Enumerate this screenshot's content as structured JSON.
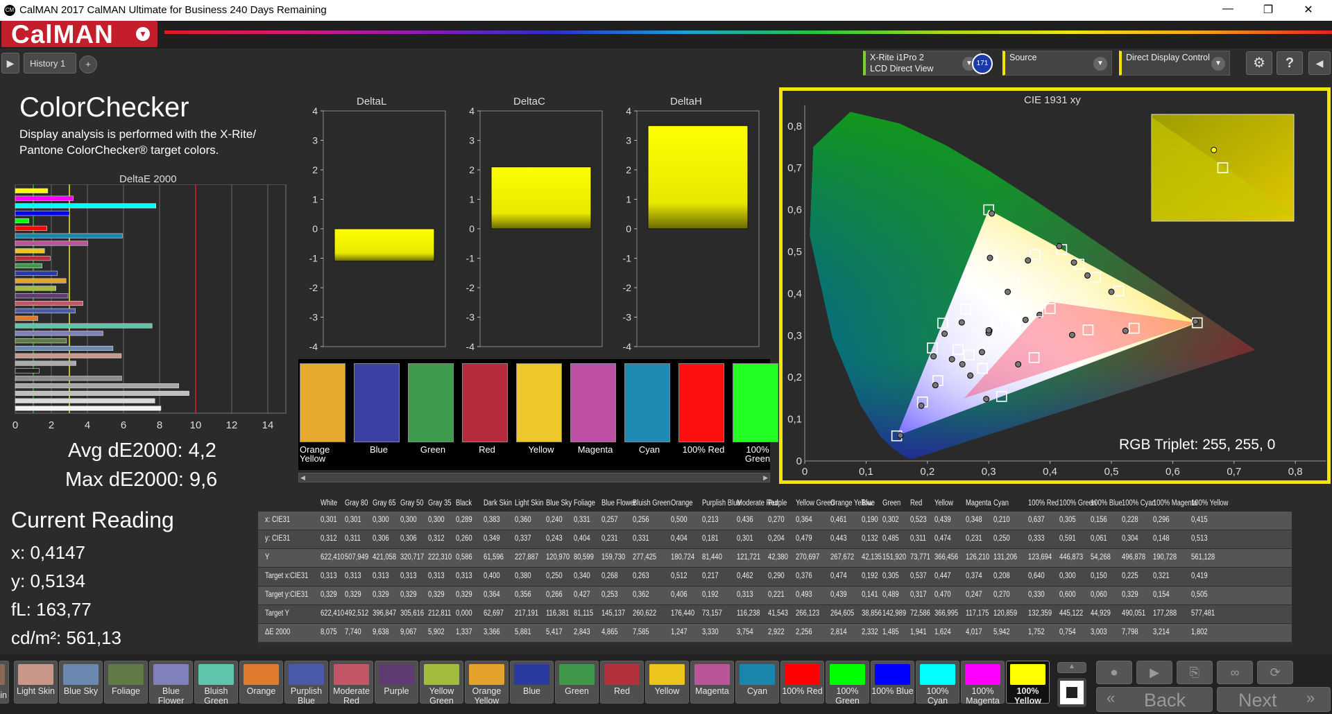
{
  "window": {
    "title": "CalMAN 2017 CalMAN Ultimate for Business 240 Days Remaining",
    "logo_text": "CM"
  },
  "brand": {
    "name": "CalMAN"
  },
  "tabs": {
    "history_label": "History 1",
    "add_label": "+"
  },
  "devices": {
    "meter": {
      "line1": "X-Rite i1Pro 2",
      "line2": "LCD Direct View",
      "badge": "171"
    },
    "source": {
      "line1": "Source"
    },
    "display": {
      "line1": "Direct Display Control"
    }
  },
  "page": {
    "title": "ColorChecker",
    "description_line1": "Display analysis is performed with the X-Rite/",
    "description_line2": "Pantone ColorChecker® target colors."
  },
  "deltae_chart": {
    "title": "DeltaE 2000",
    "ticks": [
      "0",
      "2",
      "4",
      "6",
      "8",
      "10",
      "12",
      "14"
    ],
    "avg_label": "Avg dE2000: 4,2",
    "max_label": "Max dE2000: 9,6"
  },
  "current_reading": {
    "title": "Current Reading",
    "x": "x: 0,4147",
    "y": "y: 0,5134",
    "fl": "fL: 163,77",
    "cdm2": "cd/m²: 561,13"
  },
  "delta_charts": [
    {
      "title": "DeltaL",
      "value": -1.1,
      "ticks": [
        "4",
        "3",
        "2",
        "1",
        "0",
        "-1",
        "-2",
        "-3",
        "-4"
      ]
    },
    {
      "title": "DeltaC",
      "value": 2.1,
      "ticks": [
        "4",
        "3",
        "2",
        "1",
        "0",
        "-1",
        "-2",
        "-3",
        "-4"
      ]
    },
    {
      "title": "DeltaH",
      "value": 3.5,
      "ticks": [
        "4",
        "3",
        "2",
        "1",
        "0",
        "-1",
        "-2",
        "-3",
        "-4"
      ]
    }
  ],
  "swatch_strip": [
    {
      "label": "Orange Yellow",
      "color": "#e8a92f"
    },
    {
      "label": "Blue",
      "color": "#3c3fa3"
    },
    {
      "label": "Green",
      "color": "#3f9c4f"
    },
    {
      "label": "Red",
      "color": "#b52b3b"
    },
    {
      "label": "Yellow",
      "color": "#eec82a"
    },
    {
      "label": "Magenta",
      "color": "#bd4fa5"
    },
    {
      "label": "Cyan",
      "color": "#1f8ab4"
    },
    {
      "label": "100% Red",
      "color": "#ff1010"
    },
    {
      "label": "100% Green",
      "color": "#22ff22"
    }
  ],
  "cie": {
    "title": "CIE 1931 xy",
    "rgb_triplet": "RGB Triplet: 255, 255, 0",
    "x_ticks": [
      "0",
      "0,1",
      "0,2",
      "0,3",
      "0,4",
      "0,5",
      "0,6",
      "0,7",
      "0,8"
    ],
    "y_ticks": [
      "0,8",
      "0,7",
      "0,6",
      "0,5",
      "0,4",
      "0,3",
      "0,2",
      "0,1",
      "0"
    ]
  },
  "table": {
    "columns": [
      "",
      "White",
      "Gray 80",
      "Gray 65",
      "Gray 50",
      "Gray 35",
      "Black",
      "Dark Skin",
      "Light Skin",
      "Blue Sky",
      "Foliage",
      "Blue Flower",
      "Bluish Green",
      "Orange",
      "Purplish Blue",
      "Moderate Red",
      "Purple",
      "Yellow Green",
      "Orange Yellow",
      "Blue",
      "Green",
      "Red",
      "Yellow",
      "Magenta",
      "Cyan",
      "100% Red",
      "100% Green",
      "100% Blue",
      "100% Cyan",
      "100% Magenta",
      "100% Yellow"
    ],
    "rows": [
      [
        "x: CIE31",
        "0,301",
        "0,301",
        "0,300",
        "0,300",
        "0,300",
        "0,289",
        "0,383",
        "0,360",
        "0,240",
        "0,331",
        "0,257",
        "0,256",
        "0,500",
        "0,213",
        "0,436",
        "0,270",
        "0,364",
        "0,461",
        "0,190",
        "0,302",
        "0,523",
        "0,439",
        "0,348",
        "0,210",
        "0,637",
        "0,305",
        "0,156",
        "0,228",
        "0,296",
        "0,415"
      ],
      [
        "y: CIE31",
        "0,312",
        "0,311",
        "0,306",
        "0,306",
        "0,312",
        "0,260",
        "0,349",
        "0,337",
        "0,243",
        "0,404",
        "0,231",
        "0,331",
        "0,404",
        "0,181",
        "0,301",
        "0,204",
        "0,479",
        "0,443",
        "0,132",
        "0,485",
        "0,311",
        "0,474",
        "0,231",
        "0,250",
        "0,333",
        "0,591",
        "0,061",
        "0,304",
        "0,148",
        "0,513"
      ],
      [
        "Y",
        "622,410",
        "507,949",
        "421,058",
        "320,717",
        "222,310",
        "0,586",
        "61,596",
        "227,887",
        "120,970",
        "80,599",
        "159,730",
        "277,425",
        "180,724",
        "81,440",
        "121,721",
        "42,380",
        "270,697",
        "267,672",
        "42,135",
        "151,920",
        "73,771",
        "366,456",
        "126,210",
        "131,206",
        "123,694",
        "446,873",
        "54,268",
        "496,878",
        "190,728",
        "561,128"
      ],
      [
        "Target x:CIE31",
        "0,313",
        "0,313",
        "0,313",
        "0,313",
        "0,313",
        "0,313",
        "0,400",
        "0,380",
        "0,250",
        "0,340",
        "0,268",
        "0,263",
        "0,512",
        "0,217",
        "0,462",
        "0,290",
        "0,376",
        "0,474",
        "0,192",
        "0,305",
        "0,537",
        "0,447",
        "0,374",
        "0,208",
        "0,640",
        "0,300",
        "0,150",
        "0,225",
        "0,321",
        "0,419"
      ],
      [
        "Target y:CIE31",
        "0,329",
        "0,329",
        "0,329",
        "0,329",
        "0,329",
        "0,329",
        "0,364",
        "0,356",
        "0,266",
        "0,427",
        "0,253",
        "0,362",
        "0,406",
        "0,192",
        "0,313",
        "0,221",
        "0,493",
        "0,439",
        "0,141",
        "0,489",
        "0,317",
        "0,470",
        "0,247",
        "0,270",
        "0,330",
        "0,600",
        "0,060",
        "0,329",
        "0,154",
        "0,505"
      ],
      [
        "Target Y",
        "622,410",
        "492,512",
        "396,847",
        "305,616",
        "212,811",
        "0,000",
        "62,697",
        "217,191",
        "116,381",
        "81,115",
        "145,137",
        "260,622",
        "176,440",
        "73,157",
        "116,238",
        "41,543",
        "266,123",
        "264,605",
        "38,856",
        "142,989",
        "72,586",
        "366,995",
        "117,175",
        "120,859",
        "132,359",
        "445,122",
        "44,929",
        "490,051",
        "177,288",
        "577,481"
      ],
      [
        "ΔE 2000",
        "8,075",
        "7,740",
        "9,638",
        "9,067",
        "5,902",
        "1,337",
        "3,366",
        "5,881",
        "5,417",
        "2,843",
        "4,865",
        "7,585",
        "1,247",
        "3,330",
        "3,754",
        "2,922",
        "2,256",
        "2,814",
        "2,332",
        "1,485",
        "1,941",
        "1,624",
        "4,017",
        "5,942",
        "1,752",
        "0,754",
        "3,003",
        "7,798",
        "3,214",
        "1,802"
      ]
    ]
  },
  "bottom_swatches": [
    {
      "label": "in",
      "color": "#8a6a55"
    },
    {
      "label": "Light Skin",
      "color": "#c9968a"
    },
    {
      "label": "Blue Sky",
      "color": "#6a88b0"
    },
    {
      "label": "Foliage",
      "color": "#5f7a45"
    },
    {
      "label": "Blue Flower",
      "color": "#8080bb"
    },
    {
      "label": "Bluish Green",
      "color": "#5fc4ac"
    },
    {
      "label": "Orange",
      "color": "#e07a2d"
    },
    {
      "label": "Purplish Blue",
      "color": "#4a5aa8"
    },
    {
      "label": "Moderate Red",
      "color": "#c25566"
    },
    {
      "label": "Purple",
      "color": "#5e3c72"
    },
    {
      "label": "Yellow Green",
      "color": "#a2bc3e"
    },
    {
      "label": "Orange Yellow",
      "color": "#e4a12c"
    },
    {
      "label": "Blue",
      "color": "#2a3aa0"
    },
    {
      "label": "Green",
      "color": "#3f984a"
    },
    {
      "label": "Red",
      "color": "#b2303a"
    },
    {
      "label": "Yellow",
      "color": "#ecc51c"
    },
    {
      "label": "Magenta",
      "color": "#bb5599"
    },
    {
      "label": "Cyan",
      "color": "#1a86ad"
    },
    {
      "label": "100% Red",
      "color": "#ff0000"
    },
    {
      "label": "100% Green",
      "color": "#00ff00"
    },
    {
      "label": "100% Blue",
      "color": "#0000ff"
    },
    {
      "label": "100% Cyan",
      "color": "#00ffff"
    },
    {
      "label": "100% Magenta",
      "color": "#ff00ff"
    },
    {
      "label": "100% Yellow",
      "color": "#ffff00"
    }
  ],
  "nav": {
    "back": "Back",
    "next": "Next"
  },
  "colors": {
    "accent_yellow": "#f2e600",
    "brand_red": "#c41e2a"
  }
}
